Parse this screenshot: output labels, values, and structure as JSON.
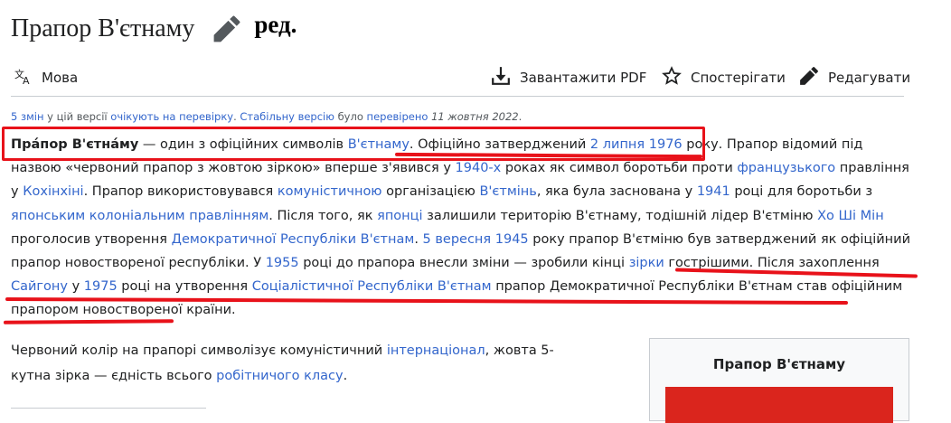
{
  "page": {
    "title": "Прапор В'єтнаму",
    "edit_label": "ред."
  },
  "toolbar": {
    "language": "Мова",
    "download_pdf": "Завантажити PDF",
    "watch": "Спостерігати",
    "edit": "Редагувати"
  },
  "notice": {
    "changes_link": "5 змін",
    "text1": " у цій версії ",
    "pending_link": "очікують на перевірку",
    "text2": ". ",
    "stable_link": "Стабільну версію",
    "text3": " було ",
    "checked_link": "перевірено",
    "text4": " ",
    "date": "11 жовтня 2022",
    "text5": "."
  },
  "article": {
    "p1": [
      {
        "t": "b",
        "v": "Пра́пор В'єтна́му"
      },
      {
        "t": "text",
        "v": " — один з офіційних символів "
      },
      {
        "t": "link",
        "v": "В'єтнаму"
      },
      {
        "t": "text",
        "v": ". Офіційно затверджений "
      },
      {
        "t": "link",
        "v": "2 липня 1976"
      },
      {
        "t": "text",
        "v": " року. Прапор відомий під назвою «червоний прапор з жовтою зіркою» вперше з'явився у "
      },
      {
        "t": "link",
        "v": "1940-х"
      },
      {
        "t": "text",
        "v": " роках як символ боротьби проти "
      },
      {
        "t": "link",
        "v": "французького"
      },
      {
        "t": "text",
        "v": " правління у "
      },
      {
        "t": "link",
        "v": "Кохінхіні"
      },
      {
        "t": "text",
        "v": ". Прапор використовувався "
      },
      {
        "t": "link",
        "v": "комуністичною"
      },
      {
        "t": "text",
        "v": " організацією "
      },
      {
        "t": "link",
        "v": "В'єтмінь"
      },
      {
        "t": "text",
        "v": ", яка була заснована у "
      },
      {
        "t": "link",
        "v": "1941"
      },
      {
        "t": "text",
        "v": " році для боротьби з "
      },
      {
        "t": "link",
        "v": "японським колоніальним правлінням"
      },
      {
        "t": "text",
        "v": ". Після того, як "
      },
      {
        "t": "link",
        "v": "японці"
      },
      {
        "t": "text",
        "v": " залишили територію В'єтнаму, тодішній лідер В'єтміню "
      },
      {
        "t": "link",
        "v": "Хо Ші Мін"
      },
      {
        "t": "text",
        "v": " проголосив утворення "
      },
      {
        "t": "link",
        "v": "Демократичної Республіки В'єтнам"
      },
      {
        "t": "text",
        "v": ". "
      },
      {
        "t": "link",
        "v": "5 вересня 1945"
      },
      {
        "t": "text",
        "v": " року прапор В'єтміню був затверджений як офіційний прапор новоствореної республіки. У "
      },
      {
        "t": "link",
        "v": "1955"
      },
      {
        "t": "text",
        "v": " році до прапора внесли зміни — зробили кінці "
      },
      {
        "t": "link",
        "v": "зірки"
      },
      {
        "t": "text",
        "v": " гострішими. Після захоплення "
      },
      {
        "t": "link",
        "v": "Сайгону"
      },
      {
        "t": "text",
        "v": " у "
      },
      {
        "t": "link",
        "v": "1975"
      },
      {
        "t": "text",
        "v": " році на утворення "
      },
      {
        "t": "link",
        "v": "Соціалістичної Республіки В'єтнам"
      },
      {
        "t": "text",
        "v": " прапор Демократичної Республіки В'єтнам став офіційним прапором новоствореної країни."
      }
    ],
    "p2": [
      {
        "t": "text",
        "v": "Червоний колір на прапорі символізує комуністичний "
      },
      {
        "t": "link",
        "v": "інтернаціонал"
      },
      {
        "t": "text",
        "v": ", жовта 5-кутна зірка — єдність всього "
      },
      {
        "t": "link",
        "v": "робітничого класу"
      },
      {
        "t": "text",
        "v": "."
      }
    ]
  },
  "infobox": {
    "caption": "Прапор В'єтнаму",
    "flag_color": "#da251d"
  },
  "colors": {
    "link": "#3366cc",
    "annotation": "#e8121a"
  }
}
